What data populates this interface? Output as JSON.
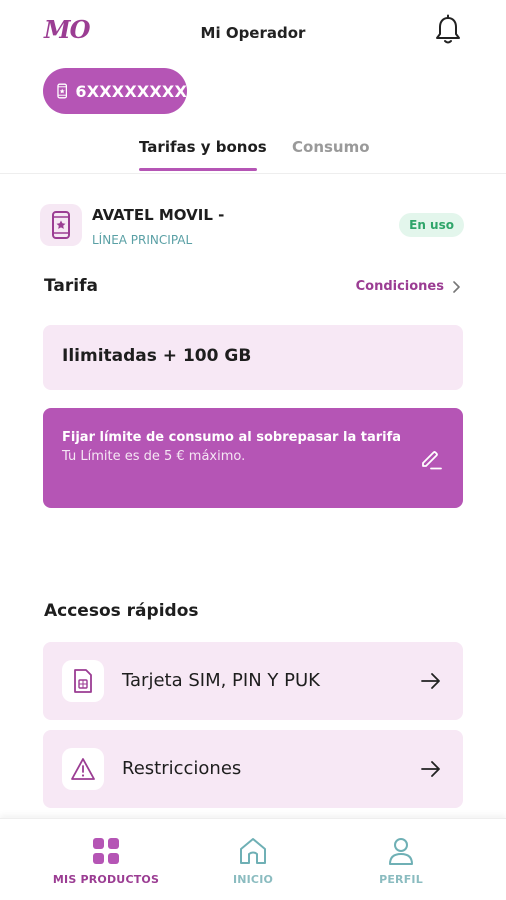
{
  "header": {
    "logo": "MO",
    "title": "Mi Operador",
    "icons": {
      "notifications": "bell-icon"
    }
  },
  "phone_selector": {
    "number": "6XXXXXXXX",
    "icon": "phone-icon"
  },
  "tabs": [
    {
      "label": "Tarifas y bonos",
      "active": true
    },
    {
      "label": "Consumo",
      "active": false
    }
  ],
  "line": {
    "name": "AVATEL MOVIL -",
    "type": "LÍNEA PRINCIPAL",
    "status": "En uso"
  },
  "tariff": {
    "section_title": "Tarifa",
    "conditions_link": "Condiciones",
    "plan": "Ilimitadas + 100 GB"
  },
  "limit": {
    "title": "Fijar límite de consumo al sobrepasar la tarifa",
    "subtitle": "Tu Límite es de 5 € máximo."
  },
  "quick_access": {
    "title": "Accesos rápidos",
    "items": [
      {
        "label": "Tarjeta SIM, PIN Y PUK",
        "icon": "sim-card-icon"
      },
      {
        "label": "Restricciones",
        "icon": "warning-icon"
      }
    ]
  },
  "bottom_nav": [
    {
      "label": "MIS PRODUCTOS",
      "icon": "grid-icon",
      "active": true
    },
    {
      "label": "INICIO",
      "icon": "home-icon",
      "active": false
    },
    {
      "label": "PERFIL",
      "icon": "user-icon",
      "active": false
    }
  ],
  "colors": {
    "brand": "#b555b5",
    "brand_dark": "#9b3d93",
    "card_bg": "#f7e8f5",
    "status_green": "#2fa56a",
    "teal_inactive": "#8bbcc0"
  }
}
